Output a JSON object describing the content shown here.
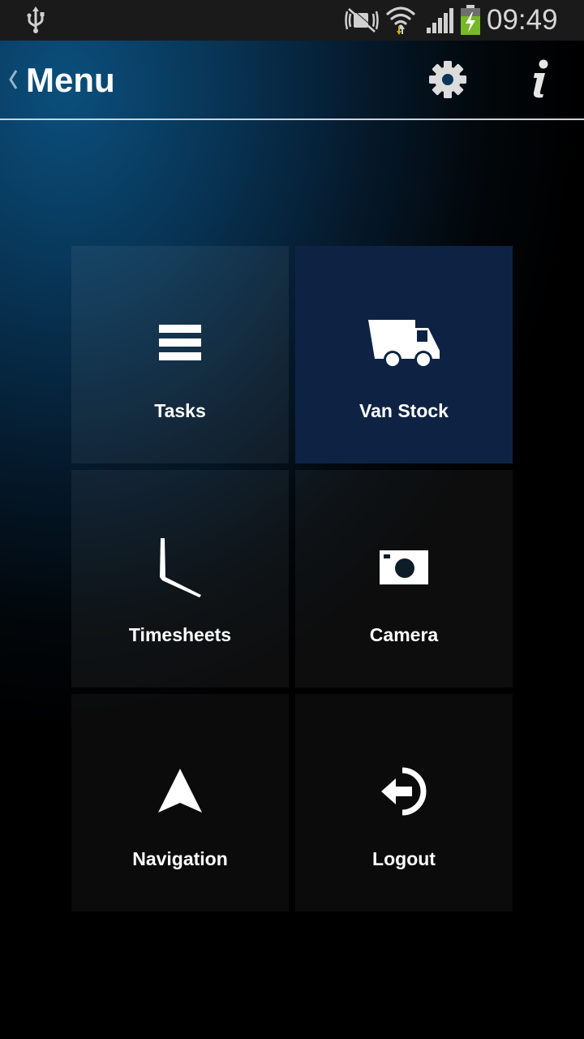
{
  "status_bar": {
    "time": "09:49",
    "icons": [
      "usb-icon",
      "mute-icon",
      "wifi-icon",
      "signal-icon",
      "battery-charging-icon"
    ]
  },
  "action_bar": {
    "title": "Menu",
    "back_icon": "chevron-left-icon",
    "settings_icon": "gear-icon",
    "info_icon": "info-icon"
  },
  "menu": {
    "tasks": {
      "label": "Tasks",
      "icon": "list-icon"
    },
    "van_stock": {
      "label": "Van Stock",
      "icon": "truck-icon"
    },
    "timesheets": {
      "label": "Timesheets",
      "icon": "clock-icon"
    },
    "camera": {
      "label": "Camera",
      "icon": "camera-icon"
    },
    "navigation": {
      "label": "Navigation",
      "icon": "navigation-arrow-icon"
    },
    "logout": {
      "label": "Logout",
      "icon": "logout-icon"
    }
  },
  "colors": {
    "status_bar_bg": "#1a1a1a",
    "background_accent": "#0b4f7c",
    "van_stock_tile": "#0e2344",
    "text": "#ffffff"
  }
}
